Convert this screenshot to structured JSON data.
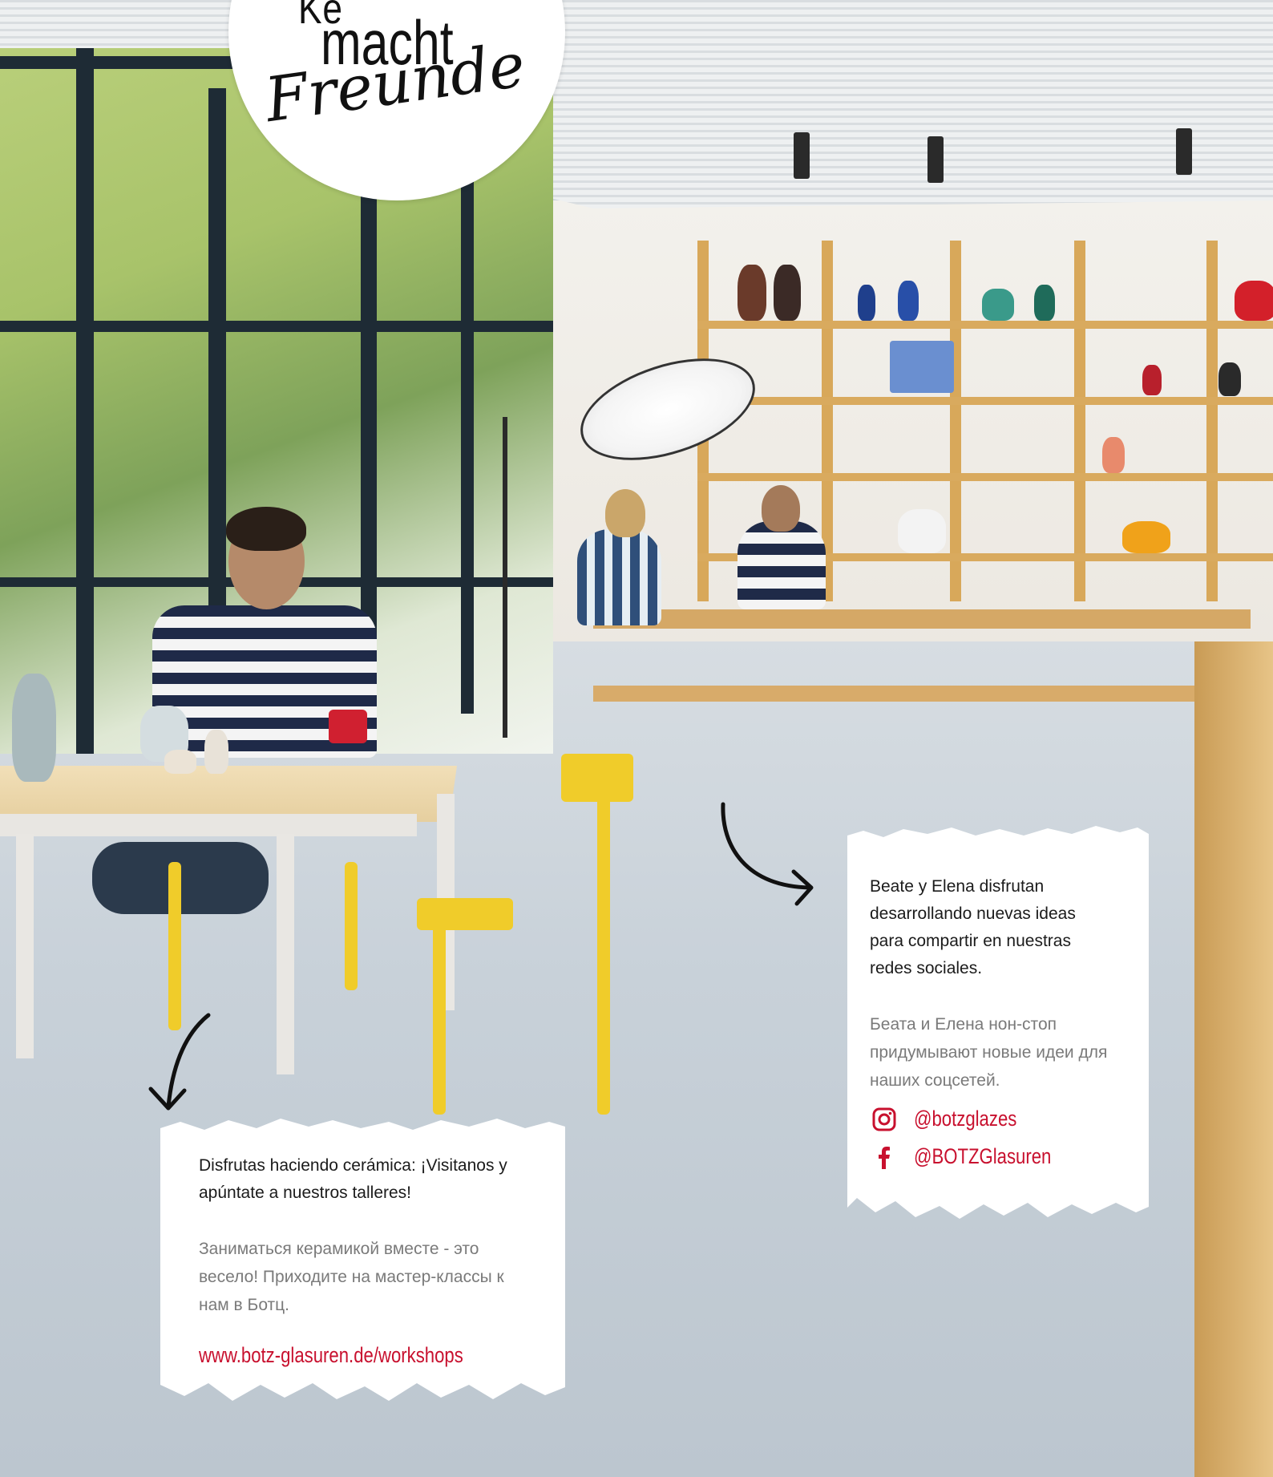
{
  "badge": {
    "line1": "Ke",
    "line2": "macht",
    "line3": "Freunde"
  },
  "card_right": {
    "text_es": "Beate y Elena disfrutan desarrollando nuevas ideas para compartir en nuestras redes sociales.",
    "text_ru": "Беата и Елена нон-стоп придумывают новые идеи для наших соцсетей.",
    "social": [
      {
        "icon": "instagram-icon",
        "handle": "@botzglazes"
      },
      {
        "icon": "facebook-icon",
        "handle": "@BOTZGlasuren"
      }
    ]
  },
  "card_left": {
    "text_es": "Disfrutas haciendo cerámica: ¡Visitanos y apúntate a nuestros talleres!",
    "text_ru": "Заниматься керамикой вместе - это весело! Приходите на мастер-классы к нам в Ботц.",
    "link": "www.botz-glasuren.de/workshops"
  },
  "colors": {
    "accent_red": "#c8102e",
    "text_dark": "#1b1b1b",
    "text_gray": "#7a7a7a",
    "chair_yellow": "#f0cc2a"
  }
}
